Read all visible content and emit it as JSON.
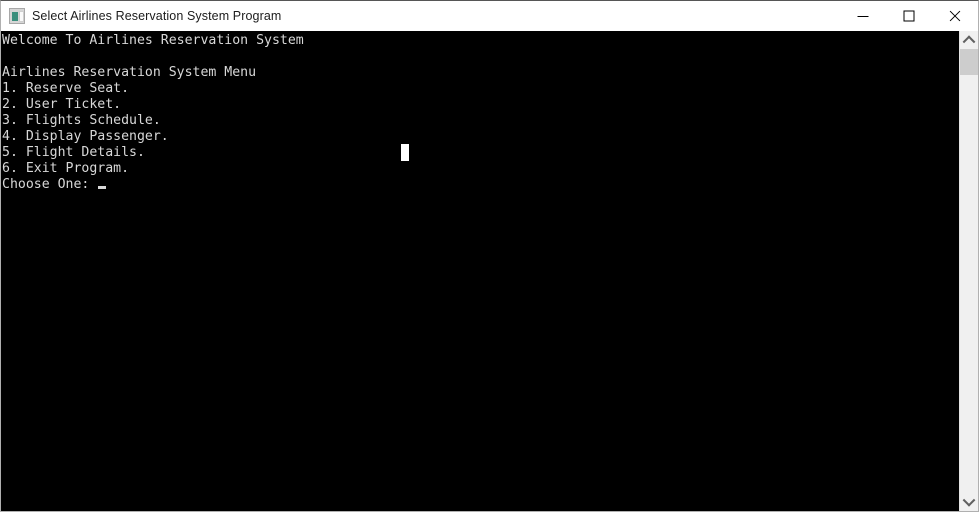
{
  "window": {
    "title": "Select Airlines Reservation System Program",
    "icon": "console-window-icon",
    "controls": {
      "minimize_label": "–",
      "maximize_label": "□",
      "close_label": "✕"
    }
  },
  "console": {
    "background_color": "#000000",
    "text_color": "#d8d8d8",
    "lines": [
      "Welcome To Airlines Reservation System",
      "",
      "Airlines Reservation System Menu",
      "1. Reserve Seat.",
      "2. User Ticket.",
      "3. Flights Schedule.",
      "4. Display Passenger.",
      "5. Flight Details.",
      "6. Exit Program.",
      "Choose One: "
    ],
    "text": "Welcome To Airlines Reservation System\n\nAirlines Reservation System Menu\n1. Reserve Seat.\n2. User Ticket.\n3. Flights Schedule.\n4. Display Passenger.\n5. Flight Details.\n6. Exit Program.\nChoose One: ",
    "prompt": "Choose One: ",
    "input_value": "",
    "caret": "underscore-caret",
    "block_cursor": "white-block-cursor"
  },
  "scrollbar": {
    "up_arrow": "scroll-up-arrow",
    "down_arrow": "scroll-down-arrow",
    "thumb": "scroll-thumb",
    "track_color": "#f0f0f0",
    "thumb_color": "#cdcdcd"
  }
}
